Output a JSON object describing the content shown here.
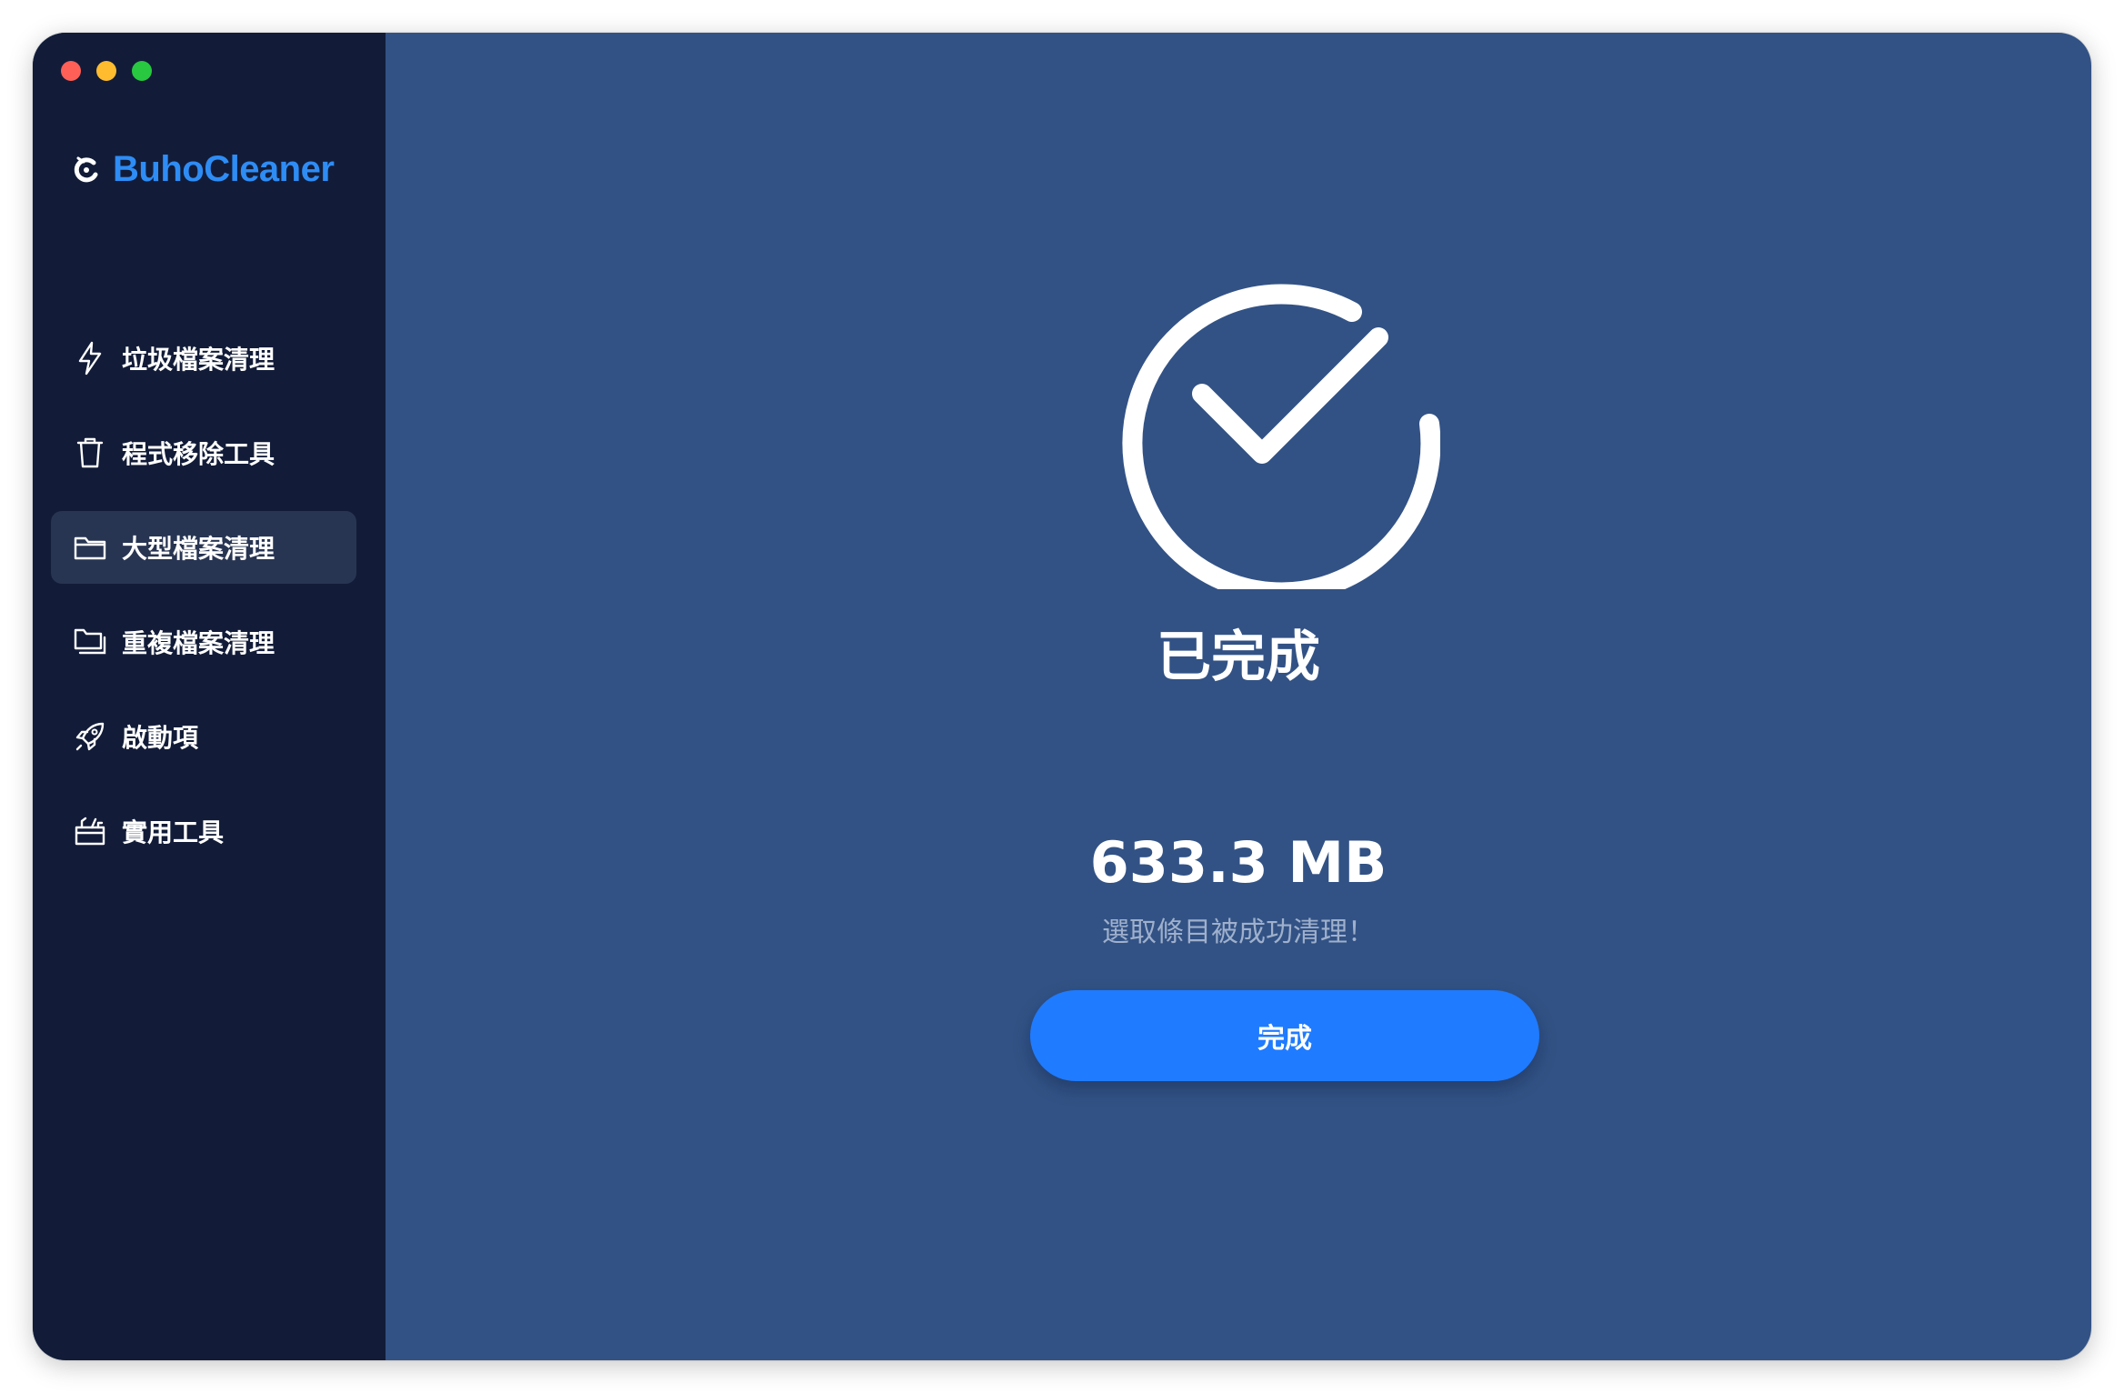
{
  "app": {
    "name": "BuhoCleaner"
  },
  "traffic_lights": {
    "close_color": "#fe5f57",
    "minimize_color": "#febc2e",
    "zoom_color": "#28c840"
  },
  "sidebar": {
    "items": [
      {
        "label": "垃圾檔案清理",
        "icon": "lightning-icon",
        "active": false
      },
      {
        "label": "程式移除工具",
        "icon": "trash-icon",
        "active": false
      },
      {
        "label": "大型檔案清理",
        "icon": "folder-icon",
        "active": true
      },
      {
        "label": "重複檔案清理",
        "icon": "duplicate-folder-icon",
        "active": false
      },
      {
        "label": "啟動項",
        "icon": "rocket-icon",
        "active": false
      },
      {
        "label": "實用工具",
        "icon": "toolbox-icon",
        "active": false
      }
    ]
  },
  "result": {
    "title": "已完成",
    "size": "633.3 MB",
    "message": "選取條目被成功清理！",
    "button_label": "完成"
  },
  "colors": {
    "sidebar_bg": "#121c38",
    "main_bg": "#325285",
    "accent": "#1f7bff",
    "brand": "#2e8cf5"
  }
}
